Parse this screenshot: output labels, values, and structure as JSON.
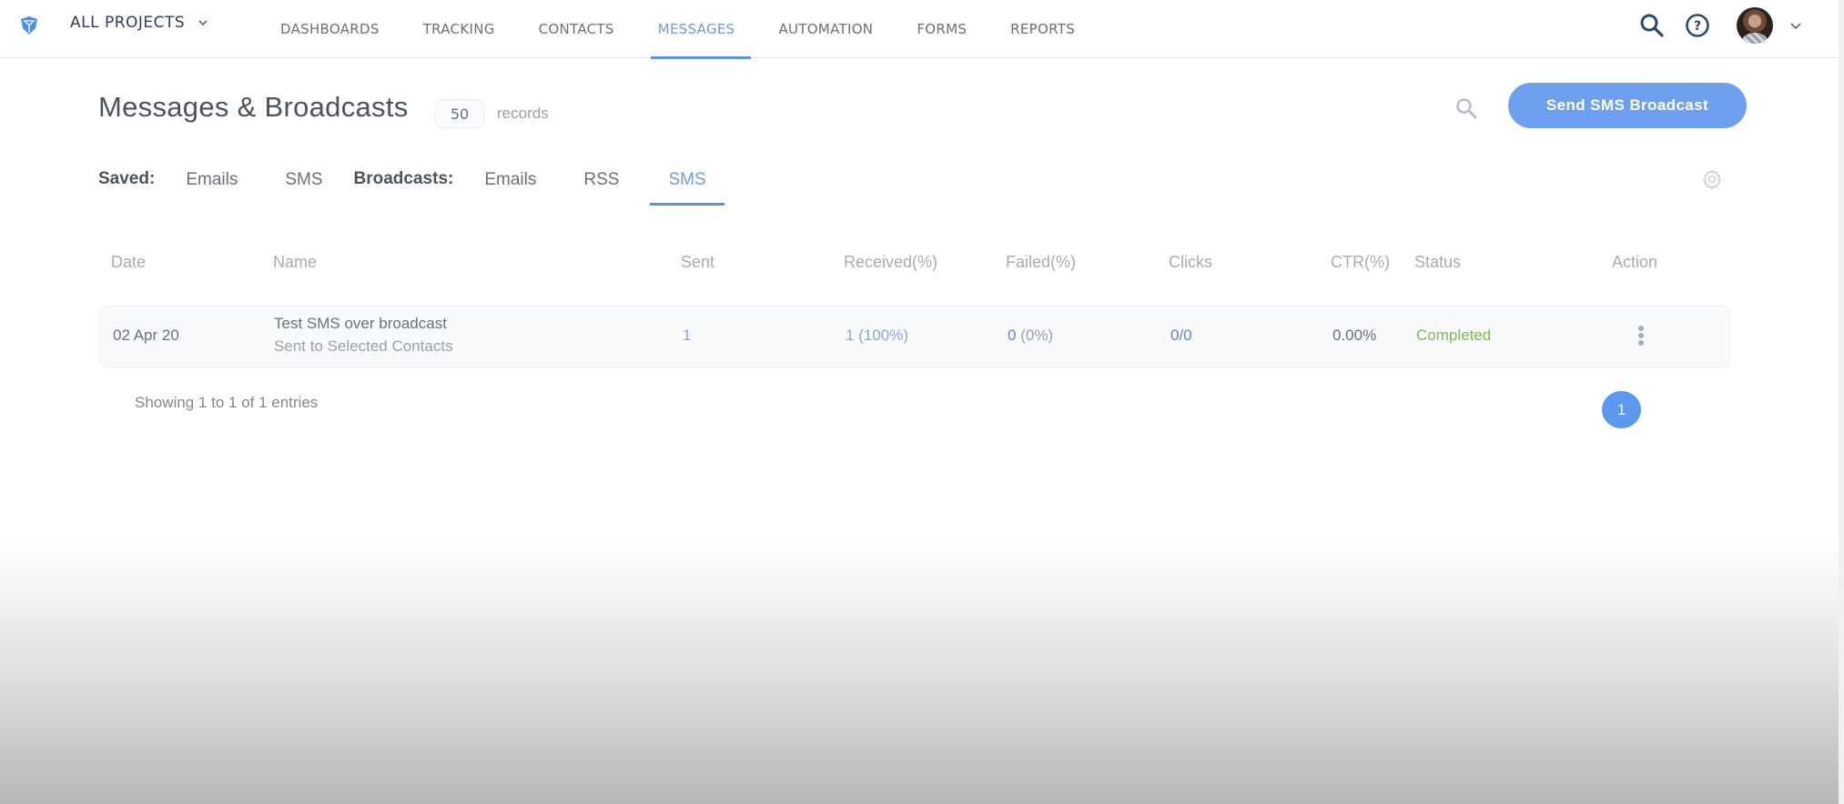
{
  "topbar": {
    "project_switcher": "ALL PROJECTS",
    "nav": [
      {
        "label": "DASHBOARDS",
        "active": false
      },
      {
        "label": "TRACKING",
        "active": false
      },
      {
        "label": "CONTACTS",
        "active": false
      },
      {
        "label": "MESSAGES",
        "active": true
      },
      {
        "label": "AUTOMATION",
        "active": false
      },
      {
        "label": "FORMS",
        "active": false
      },
      {
        "label": "REPORTS",
        "active": false
      }
    ],
    "icons": [
      "search-icon",
      "help-icon",
      "avatar",
      "chevron-down-icon"
    ]
  },
  "page": {
    "title": "Messages & Broadcasts",
    "record_count": "50",
    "records_label": "records",
    "primary_action": "Send SMS Broadcast"
  },
  "tabs": {
    "saved_label": "Saved:",
    "saved": [
      "Emails",
      "SMS"
    ],
    "broadcasts_label": "Broadcasts:",
    "broadcasts": [
      "Emails",
      "RSS",
      "SMS"
    ],
    "active": "Broadcasts/SMS"
  },
  "table": {
    "columns": [
      "Date",
      "Name",
      "Sent",
      "Received(%)",
      "Failed(%)",
      "Clicks",
      "CTR(%)",
      "Status",
      "Action"
    ],
    "rows": [
      {
        "date": "02 Apr 20",
        "name": "Test SMS over broadcast",
        "subtitle": "Sent to Selected Contacts",
        "sent": "1",
        "received": "1 (100%)",
        "failed_count": "0",
        "failed_pct": "(0%)",
        "clicks": "0/0",
        "ctr": "0.00%",
        "status": "Completed"
      }
    ]
  },
  "pagination": {
    "info": "Showing 1 to 1 of 1 entries",
    "current_page": "1"
  },
  "colors": {
    "accent": "#6ea0f0",
    "active_nav": "#6e9be0",
    "status_completed": "#7dbb4f"
  }
}
